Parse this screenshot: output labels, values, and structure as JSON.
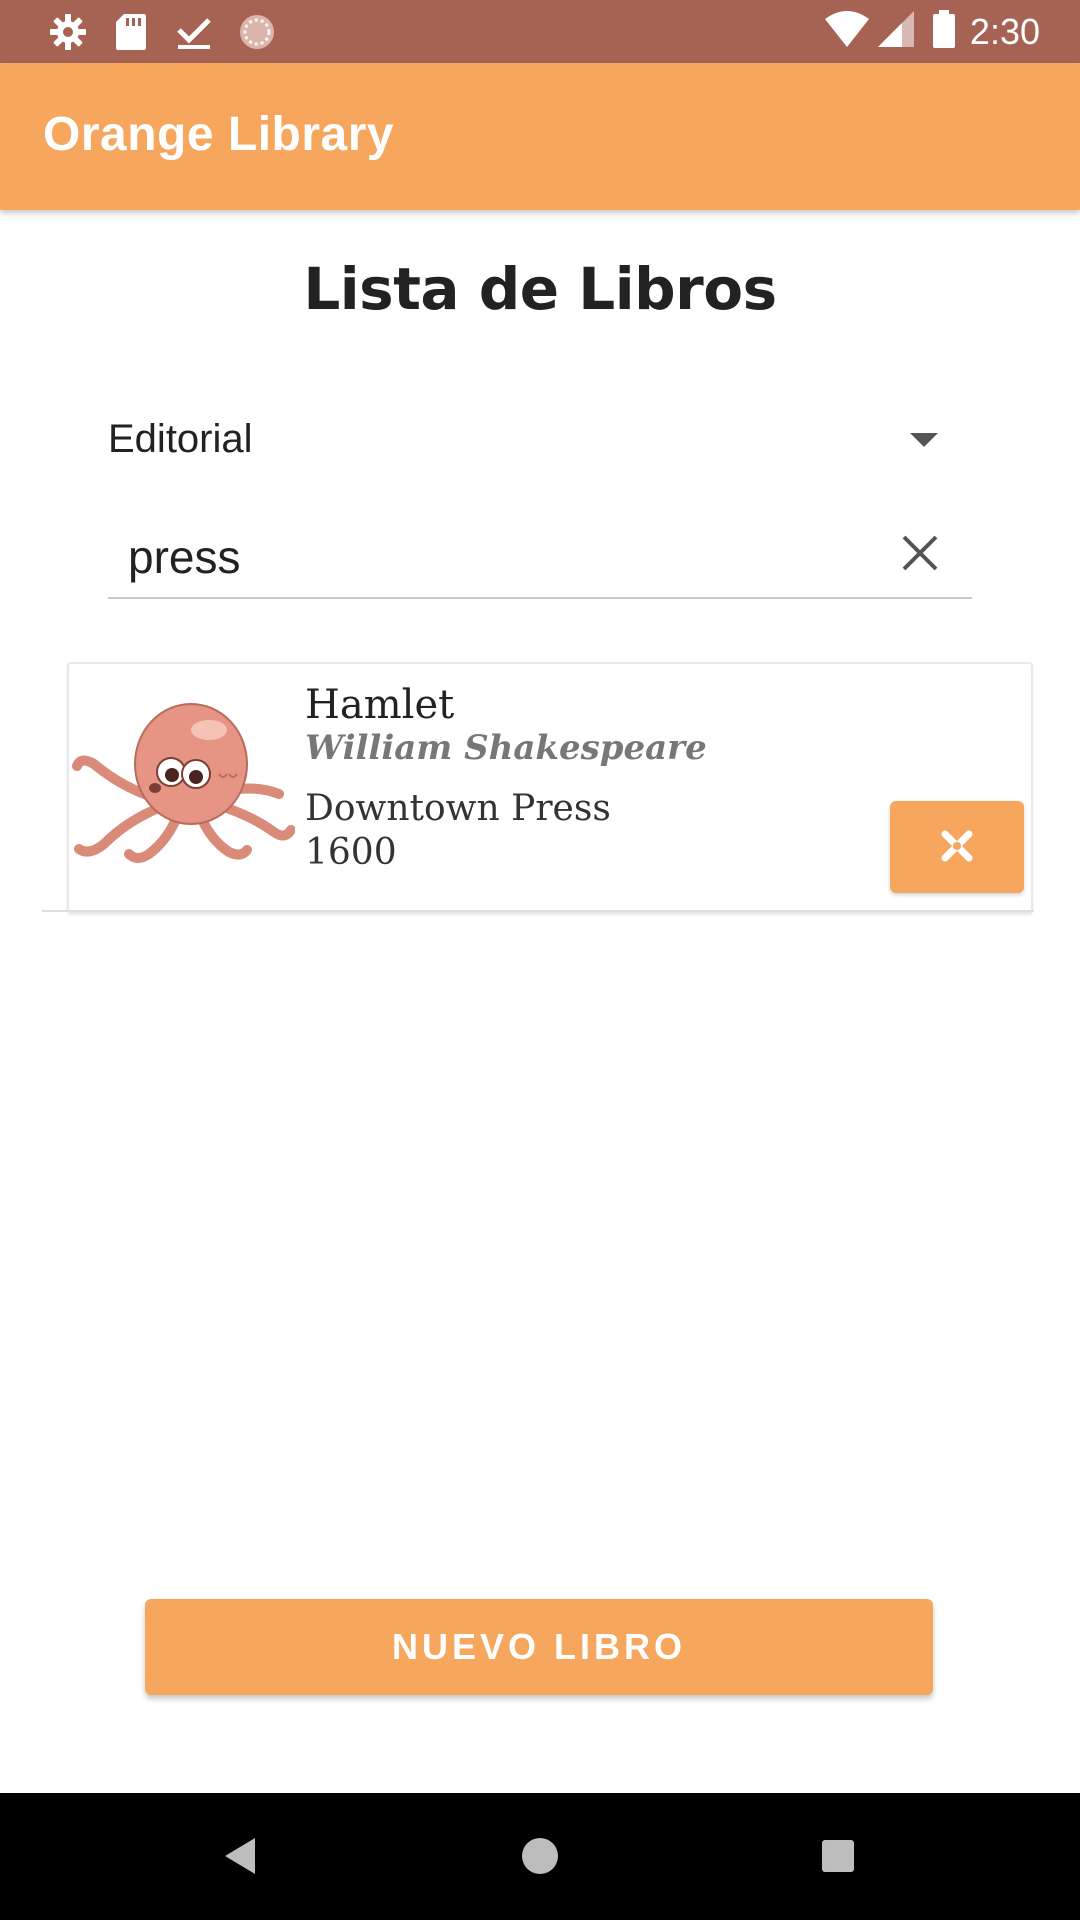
{
  "status_bar": {
    "time": "2:30",
    "icons_left": [
      "settings-icon",
      "sd-card-icon",
      "download-done-icon",
      "loading-icon"
    ],
    "icons_right": [
      "wifi-icon",
      "signal-icon",
      "battery-icon"
    ]
  },
  "app_bar": {
    "title": "Orange Library"
  },
  "page": {
    "title": "Lista de Libros"
  },
  "filter": {
    "selected": "Editorial"
  },
  "search": {
    "value": "press",
    "placeholder": ""
  },
  "books": [
    {
      "title": "Hamlet",
      "author": "William Shakespeare",
      "publisher": "Downtown Press",
      "year": "1600",
      "cover_icon": "octopus-illustration"
    }
  ],
  "actions": {
    "new_book_label": "NUEVO LIBRO"
  },
  "nav_bar": {
    "buttons": [
      "back-icon",
      "home-icon",
      "recents-icon"
    ]
  },
  "colors": {
    "status_bar": "#a66354",
    "accent": "#f7a65d",
    "nav_bar": "#000000"
  }
}
